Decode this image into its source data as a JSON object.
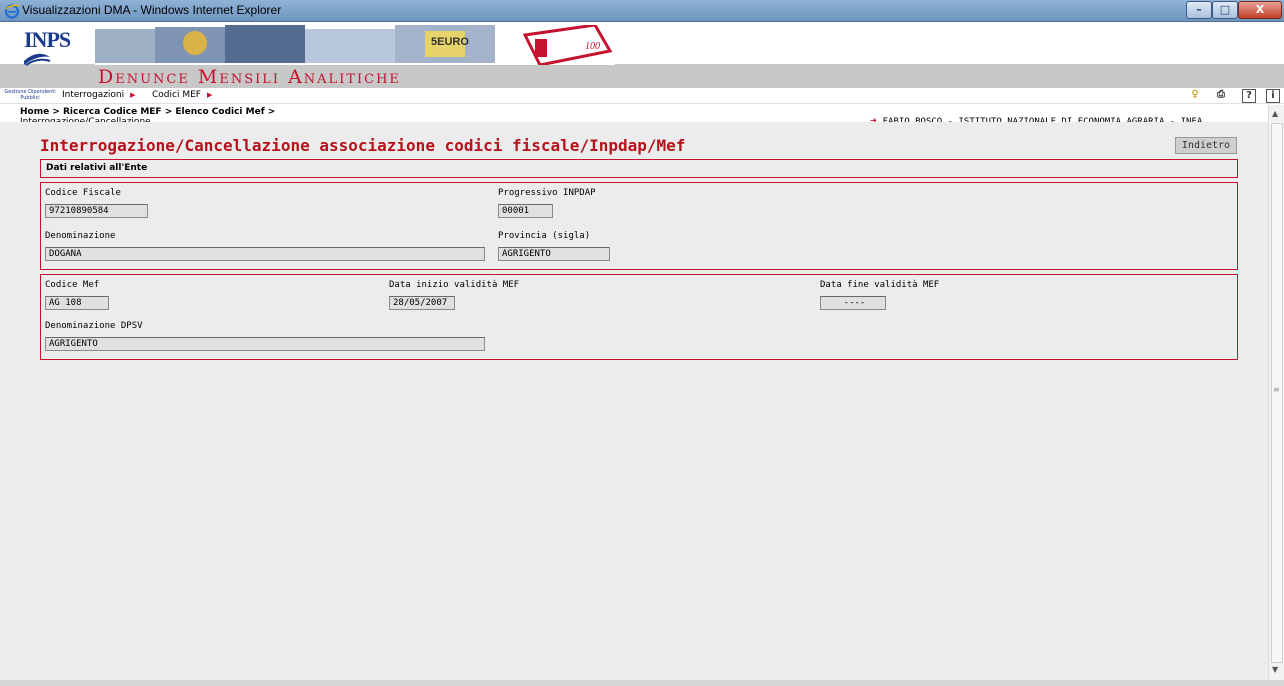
{
  "window": {
    "title": "Visualizzazioni DMA - Windows Internet Explorer",
    "minimize": "–",
    "maximize": "□",
    "close": "X"
  },
  "header": {
    "logo_text": "INPS",
    "logo_caption": "Gestione Dipendenti Pubblici",
    "app_title": "Denunce Mensili Analitiche",
    "collage_badge": "5EURO",
    "collage_note": "100"
  },
  "menu": {
    "items": [
      {
        "label": "Interrogazioni"
      },
      {
        "label": "Codici MEF"
      }
    ],
    "tools": {
      "key": "♀",
      "print": "⎙",
      "help": "?",
      "info": "i"
    }
  },
  "breadcrumb": {
    "path": "Home > Ricerca Codice MEF > Elenco Codici Mef >",
    "current": "Interrogazione/Cancellazione"
  },
  "user": {
    "text": "FABIO BOSCO  - ISTITUTO NAZIONALE DI ECONOMIA AGRARIA - INEA"
  },
  "page": {
    "title": "Interrogazione/Cancellazione associazione codici fiscale/Inpdap/Mef",
    "back_button": "Indietro",
    "section_title": "Dati relativi all'Ente"
  },
  "ente": {
    "codice_fiscale_label": "Codice Fiscale",
    "codice_fiscale": "97210890584",
    "progressivo_label": "Progressivo INPDAP",
    "progressivo": "00001",
    "denominazione_label": "Denominazione",
    "denominazione": "DOGANA",
    "provincia_label": "Provincia (sigla)",
    "provincia": "AGRIGENTO"
  },
  "mef": {
    "codice_label": "Codice Mef",
    "codice": "AG 108",
    "data_inizio_label": "Data inizio validità MEF",
    "data_inizio": "28/05/2007",
    "data_fine_label": "Data fine validità MEF",
    "data_fine": "----",
    "dpsv_label": "Denominazione DPSV",
    "dpsv": "AGRIGENTO"
  }
}
